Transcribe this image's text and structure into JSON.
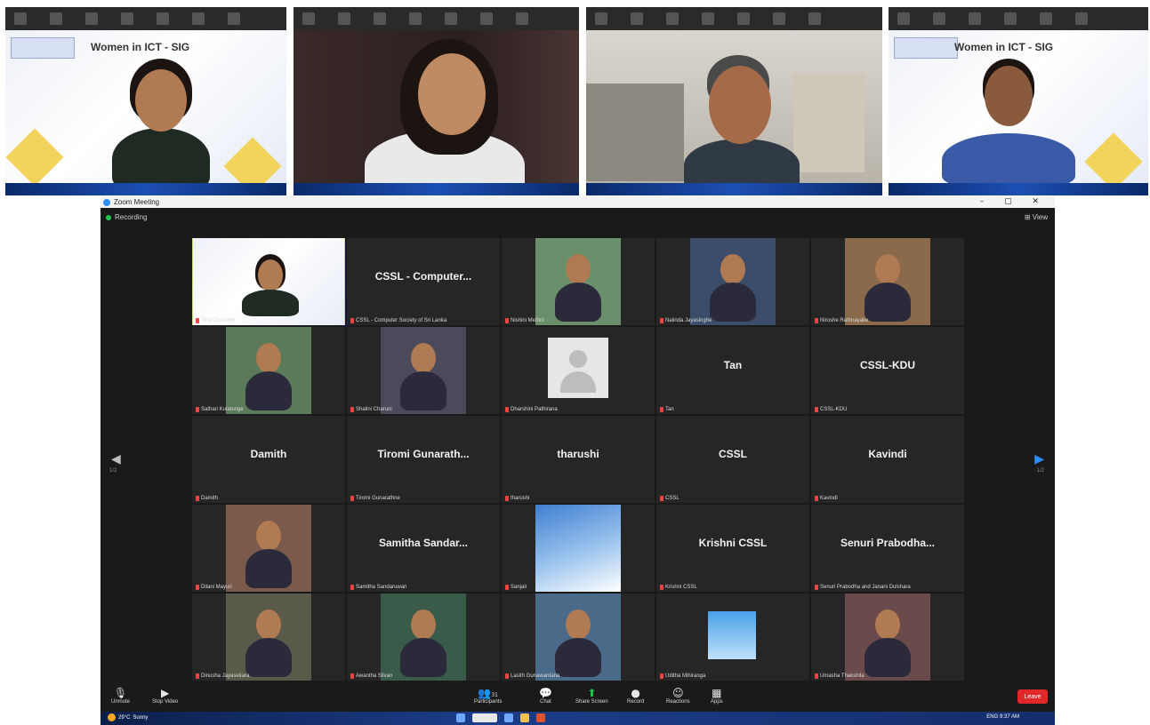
{
  "thumbnails": [
    {
      "slide_title": "Women in ICT - SIG"
    },
    {
      "slide_title": ""
    },
    {
      "slide_title": ""
    },
    {
      "slide_title": "Women in ICT - SIG"
    }
  ],
  "window": {
    "title": "Zoom Meeting",
    "recording": "Recording",
    "view": "View",
    "controls": "–  ▢  ✕"
  },
  "tiles": [
    {
      "name": "",
      "label": "Tina Dhanushi",
      "kind": "slide"
    },
    {
      "name": "CSSL - Computer...",
      "label": "CSSL - Computer Society of Sri Lanka",
      "kind": "text"
    },
    {
      "name": "",
      "label": "Nishini Methni",
      "kind": "photo"
    },
    {
      "name": "",
      "label": "Nalinda Jayasinghe",
      "kind": "photo"
    },
    {
      "name": "",
      "label": "Niroshe Rathnayake",
      "kind": "photo"
    },
    {
      "name": "",
      "label": "Sathari Kulatunge",
      "kind": "photo"
    },
    {
      "name": "",
      "label": "Shalini Charuni",
      "kind": "photo"
    },
    {
      "name": "",
      "label": "Dharshini Pathirana",
      "kind": "avatar"
    },
    {
      "name": "Tan",
      "label": "Tan",
      "kind": "text"
    },
    {
      "name": "CSSL-KDU",
      "label": "CSSL-KDU",
      "kind": "text"
    },
    {
      "name": "Damith",
      "label": "Damith",
      "kind": "text"
    },
    {
      "name": "Tiromi Gunarath...",
      "label": "Tiromi Gunarathne",
      "kind": "text"
    },
    {
      "name": "tharushi",
      "label": "tharushi",
      "kind": "text"
    },
    {
      "name": "CSSL",
      "label": "CSSL",
      "kind": "text"
    },
    {
      "name": "Kavindi",
      "label": "Kavindi",
      "kind": "text"
    },
    {
      "name": "",
      "label": "Dilani Mayuri",
      "kind": "photo"
    },
    {
      "name": "Samitha Sandar...",
      "label": "Samitha Sandaruwan",
      "kind": "text"
    },
    {
      "name": "",
      "label": "Sanjali",
      "kind": "sky"
    },
    {
      "name": "Krishni CSSL",
      "label": "Krishni CSSL",
      "kind": "text"
    },
    {
      "name": "Senuri Prabodha...",
      "label": "Senuri Prabodha and Janani Dulshara",
      "kind": "text"
    },
    {
      "name": "",
      "label": "Dinusha Jayasekara",
      "kind": "photo"
    },
    {
      "name": "",
      "label": "Awantha Silvan",
      "kind": "photo"
    },
    {
      "name": "",
      "label": "Lasith Gunawardana",
      "kind": "photo"
    },
    {
      "name": "",
      "label": "Uditha Mihiranga",
      "kind": "skybox"
    },
    {
      "name": "",
      "label": "Umasha Thakshila",
      "kind": "photo"
    }
  ],
  "pager": {
    "left": "1/2",
    "right": "1/2"
  },
  "toolbar": {
    "unmute": "Unmute",
    "stop_video": "Stop Video",
    "participants": "Participants",
    "participants_count": "31",
    "chat": "Chat",
    "share_screen": "Share Screen",
    "record": "Record",
    "reactions": "Reactions",
    "apps": "Apps",
    "leave": "Leave"
  },
  "taskbar": {
    "temp": "29°C",
    "condition": "Sunny",
    "search": "Search",
    "lang": "ENG",
    "time": "9:37 AM"
  }
}
